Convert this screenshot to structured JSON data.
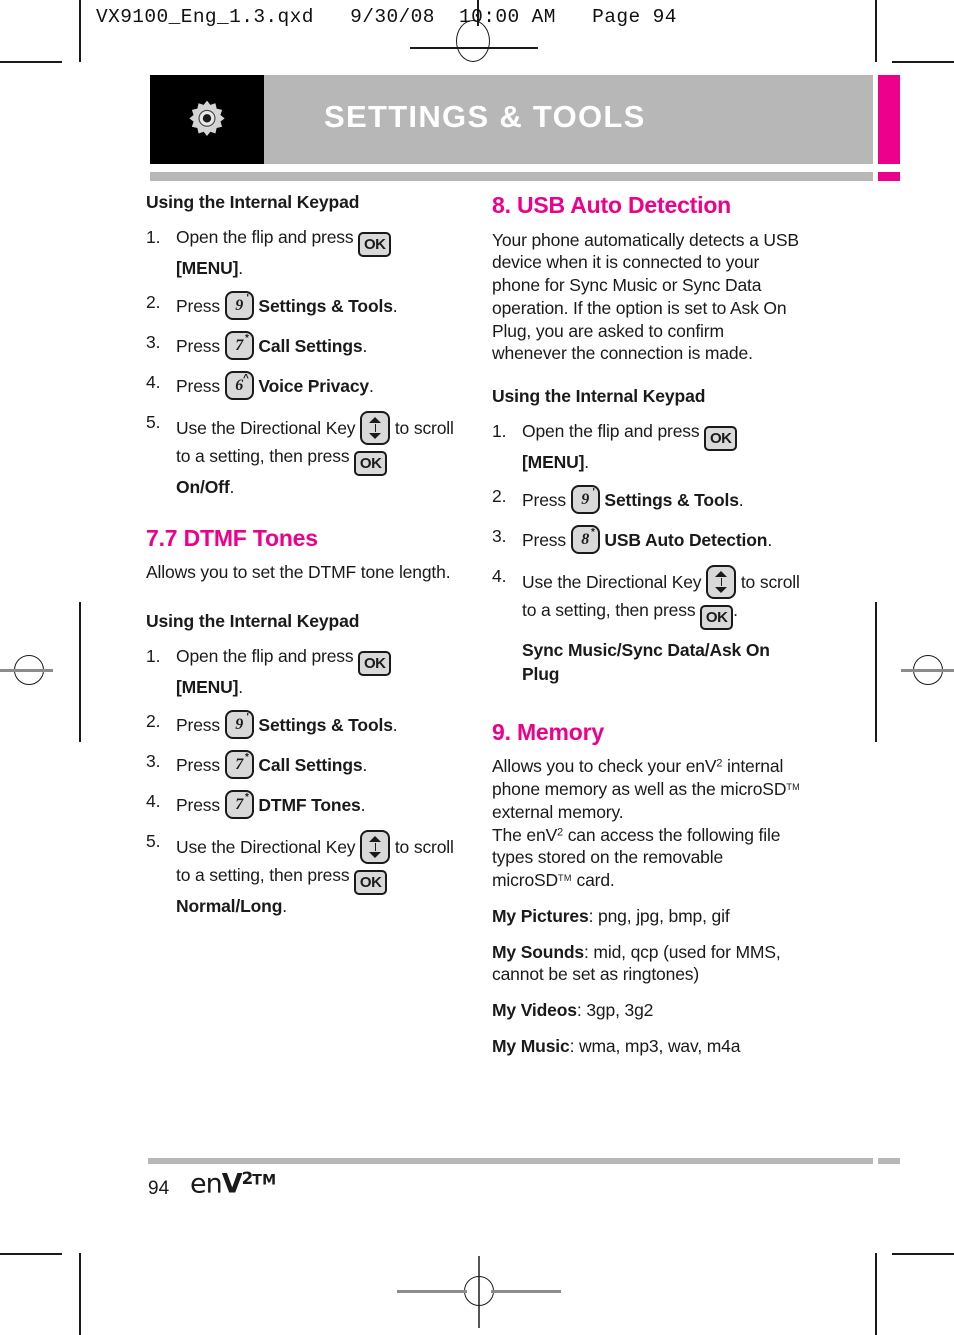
{
  "print_header": "VX9100_Eng_1.3.qxd   9/30/08  10:00 AM   Page 94",
  "banner": {
    "title": "SETTINGS & TOOLS",
    "icon": "gear-icon",
    "bg_color": "#b7b7b7",
    "accent_color": "#ec008c"
  },
  "left_column": {
    "keypad_heading_1": "Using the Internal Keypad",
    "steps_1": [
      {
        "num": "1.",
        "pre": "Open the flip and press ",
        "key": "OK",
        "post": "",
        "bold_line": "[MENU]",
        "bold_tail": "."
      },
      {
        "num": "2.",
        "pre": "Press ",
        "key": "9",
        "post": " ",
        "bold": "Settings & Tools",
        "tail": "."
      },
      {
        "num": "3.",
        "pre": "Press ",
        "key": "7",
        "post": " ",
        "bold": "Call Settings",
        "tail": "."
      },
      {
        "num": "4.",
        "pre": "Press ",
        "key": "6",
        "post": " ",
        "bold": "Voice Privacy",
        "tail": "."
      },
      {
        "num": "5.",
        "pre": "Use the Directional Key ",
        "mid": " to scroll to a setting, then press ",
        "bold_line": "On/Off",
        "bold_tail": "."
      }
    ],
    "section_title": "7.7 DTMF Tones",
    "section_body": "Allows you to set the DTMF tone length.",
    "keypad_heading_2": "Using the Internal Keypad",
    "steps_2": [
      {
        "num": "1.",
        "pre": "Open the flip and press ",
        "key": "OK",
        "bold_line": "[MENU]",
        "bold_tail": "."
      },
      {
        "num": "2.",
        "pre": "Press ",
        "key": "9",
        "bold": "Settings & Tools",
        "tail": "."
      },
      {
        "num": "3.",
        "pre": "Press ",
        "key": "7",
        "bold": "Call Settings",
        "tail": "."
      },
      {
        "num": "4.",
        "pre": "Press ",
        "key": "7",
        "bold": "DTMF Tones",
        "tail": "."
      },
      {
        "num": "5.",
        "pre": "Use the Directional Key ",
        "mid": " to scroll to a setting, then press ",
        "bold_line": "Normal/Long",
        "bold_tail": "."
      }
    ]
  },
  "right_column": {
    "section_8_title": "8. USB Auto Detection",
    "section_8_body": "Your phone automatically detects a USB device when it is connected to your phone for Sync Music or Sync Data operation. If the option is set to Ask On Plug, you are asked to confirm whenever the connection is made.",
    "keypad_heading": "Using the Internal Keypad",
    "steps": [
      {
        "num": "1.",
        "pre": "Open the flip and press ",
        "key": "OK",
        "bold_line": "[MENU]",
        "bold_tail": "."
      },
      {
        "num": "2.",
        "pre": "Press ",
        "key": "9",
        "bold": "Settings & Tools",
        "tail": "."
      },
      {
        "num": "3.",
        "pre": "Press ",
        "key": "8",
        "bold": "USB Auto Detection",
        "tail": "."
      },
      {
        "num": "4.",
        "pre": "Use the Directional Key ",
        "mid": " to scroll to a setting, then press ",
        "tail": ".",
        "sub_bold": "Sync Music/Sync Data/Ask On Plug"
      }
    ],
    "section_9_title": "9. Memory",
    "section_9_body_1_a": "Allows you to check your enV",
    "section_9_body_1_b": " internal phone memory as well as the microSD",
    "section_9_body_1_c": " external memory.",
    "section_9_body_2_a": "The enV",
    "section_9_body_2_b": " can access the following file types stored on the removable microSD",
    "section_9_body_2_c": " card.",
    "file_types": [
      {
        "label": "My Pictures",
        "value": ": png, jpg, bmp, gif"
      },
      {
        "label": "My Sounds",
        "value": ": mid, qcp (used for MMS, cannot be set as ringtones)"
      },
      {
        "label": "My Videos",
        "value": ": 3gp, 3g2"
      },
      {
        "label": "My Music",
        "value": ": wma, mp3, wav, m4a"
      }
    ]
  },
  "footer": {
    "page_number": "94",
    "logo_en": "en",
    "logo_v": "V"
  }
}
